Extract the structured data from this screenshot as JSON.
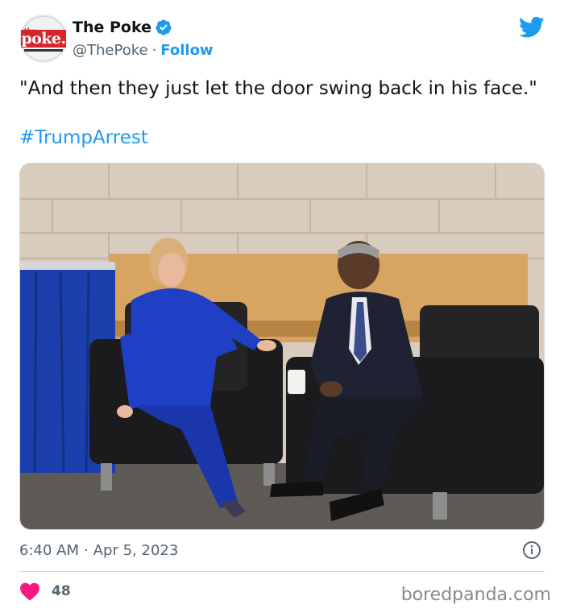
{
  "account": {
    "display_name": "The Poke",
    "handle": "@ThePoke",
    "separator": "·",
    "follow_label": "Follow",
    "avatar_logo_text": "poke.",
    "avatar_logo_prefix": "the",
    "verified_icon": "verified-badge-icon",
    "platform_icon": "twitter-bird-icon"
  },
  "tweet": {
    "text": "\"And then they just let the door swing back in his face.\"",
    "hashtag": "#TrumpArrest",
    "time": "6:40 AM",
    "separator": "·",
    "date": "Apr 5, 2023",
    "info_icon": "info-icon"
  },
  "engagement": {
    "like_icon": "heart-icon",
    "likes": "48"
  },
  "watermark": "boredpanda.com",
  "colors": {
    "accent": "#1d9bf0",
    "like": "#f91880",
    "text": "#0f1419",
    "muted": "#536471",
    "suit_blue": "#1f3fc4"
  }
}
